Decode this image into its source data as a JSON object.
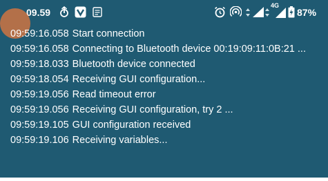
{
  "status_bar": {
    "time": "09.59",
    "battery": "87%",
    "network_label": "4G",
    "icons": [
      "upload-icon",
      "vpn-check-icon",
      "notification-icon",
      "alarm-icon",
      "hotspot-icon",
      "signal-icon",
      "lte-signal-icon",
      "battery-icon"
    ]
  },
  "log": [
    {
      "time": "09:59:16.058",
      "message": "Start connection"
    },
    {
      "time": "09:59:16.058",
      "message": "Connecting to Bluetooth device 00:19:09:11:0B:21 ..."
    },
    {
      "time": "09:59:18.033",
      "message": "Bluetooth device connected"
    },
    {
      "time": "09:59:18.054",
      "message": "Receiving GUI configuration..."
    },
    {
      "time": "09:59:19.056",
      "message": "Read timeout error"
    },
    {
      "time": "09:59:19.056",
      "message": "Receiving GUI configuration, try 2 ..."
    },
    {
      "time": "09:59:19.105",
      "message": "GUI configuration received"
    },
    {
      "time": "09:59:19.106",
      "message": "Receiving variables..."
    }
  ],
  "colors": {
    "background": "#1f5a72",
    "text": "#ffffff",
    "touch_indicator": "#e6783c"
  }
}
